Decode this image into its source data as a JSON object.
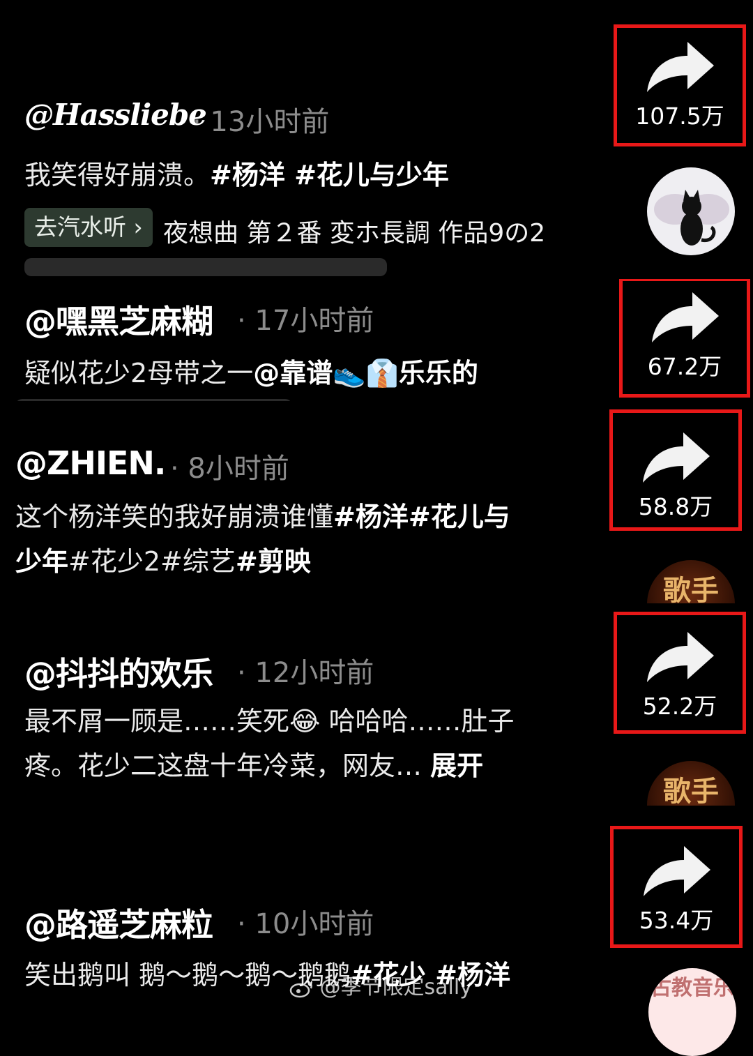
{
  "posts": [
    {
      "username": "@Hassliebe",
      "time": "· 13小时前",
      "caption_text": "我笑得好崩溃。",
      "caption_tags": "#杨洋 #花儿与少年",
      "music_chip": "去汽水听 ›",
      "music_title": "夜想曲 第２番 変ホ長調 作品9の2",
      "share_count": "107.5万"
    },
    {
      "username": "@嘿黑芝麻糊",
      "time": "· 17小时前",
      "caption_text": "疑似花少2母带之一",
      "caption_tags": "@靠谱👟👔乐乐的",
      "share_count": "67.2万"
    },
    {
      "username": "@ZHIEN.",
      "time": "· 8小时前",
      "caption_line1_text": "这个杨洋笑的我好崩溃谁懂",
      "caption_line1_tags": "#杨洋#花儿与",
      "caption_line2_a": "少年",
      "caption_line2_b": "#花少2#综艺",
      "caption_line2_c": "#剪映",
      "share_count": "58.8万",
      "avatar_text": "歌手"
    },
    {
      "username": "@抖抖的欢乐",
      "time": "· 12小时前",
      "caption_line1": "最不屑一顾是……笑死😂 哈哈哈……肚子",
      "caption_line2_text": "疼。花少二这盘十年冷菜，网友… ",
      "caption_line2_more": "展开",
      "share_count": "52.2万",
      "avatar_text": "歌手"
    },
    {
      "username": "@路遥芝麻粒",
      "time": "· 10小时前",
      "caption_text": "笑出鹅叫 鹅～鹅～鹅～鹅鹅",
      "caption_tags": "#花少 #杨洋",
      "share_count": "53.4万",
      "avatar_text": "古教音乐"
    }
  ],
  "watermark": "@季节限定sally",
  "colors": {
    "highlight_box": "#e81818",
    "background": "#000000",
    "time_text": "#8c8c8c"
  },
  "icons": {
    "share": "share-arrow-icon",
    "weibo": "weibo-icon"
  }
}
